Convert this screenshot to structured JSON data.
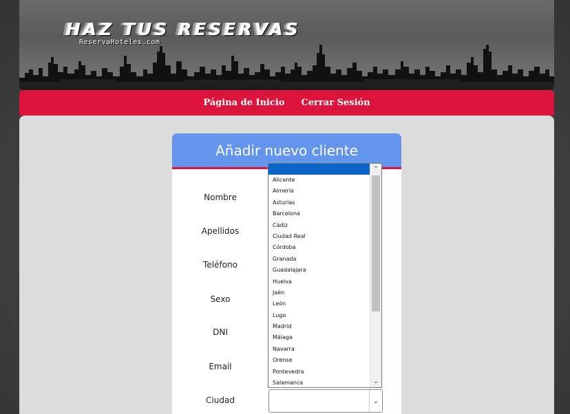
{
  "header": {
    "logo_title": "HAZ TUS RESERVAS",
    "logo_subtitle": "ReservaHoteles.com"
  },
  "nav": {
    "items": [
      {
        "label": "Página de Inicio"
      },
      {
        "label": "Cerrar Sesión"
      }
    ]
  },
  "form": {
    "title": "Añadir nuevo cliente",
    "fields": [
      {
        "label": "Nombre"
      },
      {
        "label": "Apellidos"
      },
      {
        "label": "Teléfono"
      },
      {
        "label": "Sexo"
      },
      {
        "label": "DNI"
      },
      {
        "label": "Email"
      },
      {
        "label": "Ciudad"
      }
    ],
    "city_select": {
      "selected_value": "",
      "options": [
        "",
        "Alicante",
        "Almería",
        "Asturias",
        "Barcelona",
        "Cádiz",
        "Ciudad Real",
        "Córdoba",
        "Granada",
        "Guadalajara",
        "Huelva",
        "Jaén",
        "León",
        "Lugo",
        "Madrid",
        "Málaga",
        "Navarra",
        "Orense",
        "Pontevedra",
        "Salamanca"
      ]
    }
  },
  "colors": {
    "accent_red": "#dc143c",
    "header_blue": "#6495ed",
    "selected_blue": "#0a64c8"
  }
}
